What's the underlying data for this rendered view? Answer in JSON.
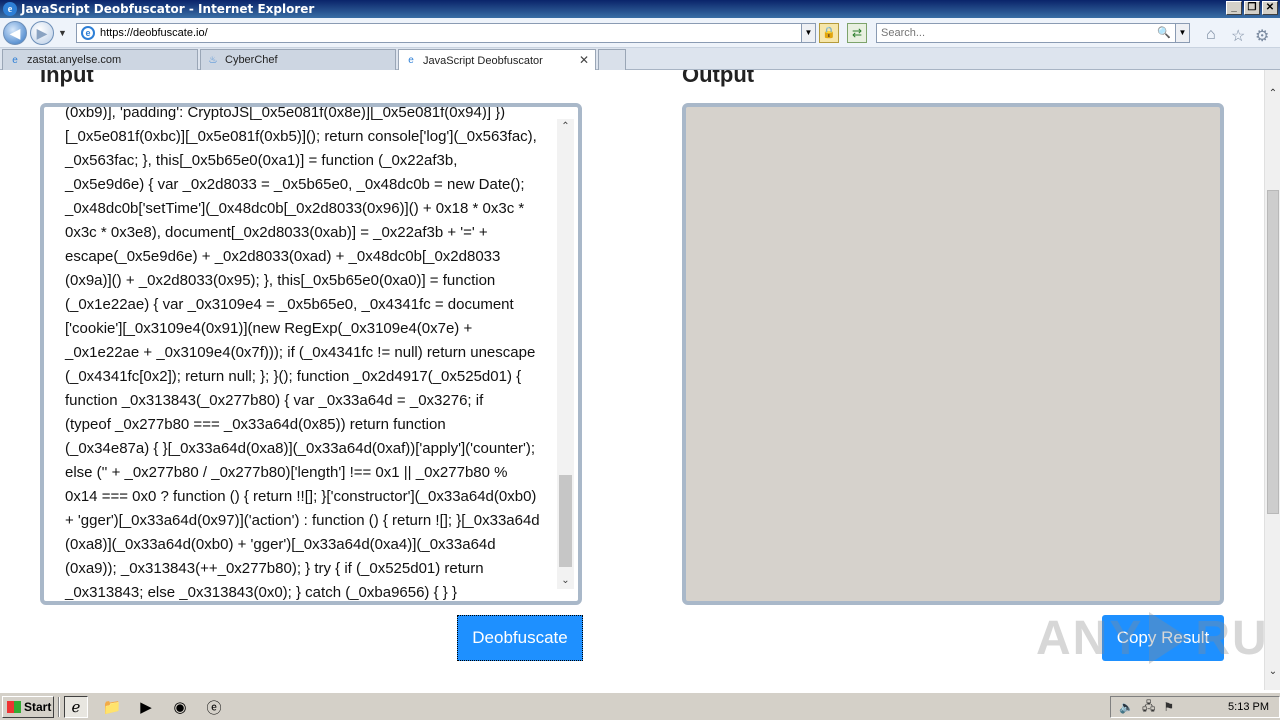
{
  "window": {
    "title": "JavaScript Deobfuscator - Internet Explorer",
    "minimize": "_",
    "maximize": "❐",
    "close": "✕"
  },
  "address_bar": {
    "url": "https://deobfuscate.io/",
    "search_placeholder": "Search..."
  },
  "tabs": [
    {
      "label": "zastat.anyelse.com",
      "active": false
    },
    {
      "label": "CyberChef",
      "active": false
    },
    {
      "label": "JavaScript Deobfuscator",
      "active": true
    }
  ],
  "page": {
    "input_heading": "Input",
    "output_heading": "Output",
    "deobfuscate_label": "Deobfuscate",
    "copy_label": "Copy Result",
    "code_lines": [
      "(0xb9)], 'padding': CryptoJS[_0x5e081f(0x8e)][_0x5e081f(0x94)] })",
      "[_0x5e081f(0xbc)][_0x5e081f(0xb5)](); return console['log'](_0x563fac),",
      "_0x563fac; }, this[_0x5b65e0(0xa1)] = function (_0x22af3b,",
      "_0x5e9d6e) { var _0x2d8033 = _0x5b65e0, _0x48dc0b = new Date();",
      "_0x48dc0b['setTime'](_0x48dc0b[_0x2d8033(0x96)]() + 0x18 * 0x3c *",
      "0x3c * 0x3e8), document[_0x2d8033(0xab)] = _0x22af3b + '=' +",
      "escape(_0x5e9d6e) + _0x2d8033(0xad) + _0x48dc0b[_0x2d8033",
      "(0x9a)]() + _0x2d8033(0x95); }, this[_0x5b65e0(0xa0)] = function",
      "(_0x1e22ae) { var _0x3109e4 = _0x5b65e0, _0x4341fc = document",
      "['cookie'][_0x3109e4(0x91)](new RegExp(_0x3109e4(0x7e) +",
      "_0x1e22ae + _0x3109e4(0x7f))); if (_0x4341fc != null) return unescape",
      "(_0x4341fc[0x2]); return null; }; }(); function _0x2d4917(_0x525d01) {",
      "function _0x313843(_0x277b80) { var _0x33a64d = _0x3276; if",
      "(typeof _0x277b80 === _0x33a64d(0x85)) return function",
      "(_0x34e87a) { }[_0x33a64d(0xa8)](_0x33a64d(0xaf))['apply']('counter');",
      "else ('' + _0x277b80 / _0x277b80)['length'] !== 0x1 || _0x277b80 %",
      "0x14 === 0x0 ? function () { return !![]; }['constructor'](_0x33a64d(0xb0)",
      "+ 'gger')[_0x33a64d(0x97)]('action') : function () { return ![]; }[_0x33a64d",
      "(0xa8)](_0x33a64d(0xb0) + 'gger')[_0x33a64d(0xa4)](_0x33a64d",
      "(0xa9)); _0x313843(++_0x277b80); } try { if (_0x525d01) return",
      "_0x313843; else _0x313843(0x0); } catch (_0xba9656) { } }"
    ]
  },
  "watermark": {
    "text_left": "ANY",
    "text_right": "RUN"
  },
  "taskbar": {
    "start_label": "Start",
    "clock": "5:13 PM"
  }
}
